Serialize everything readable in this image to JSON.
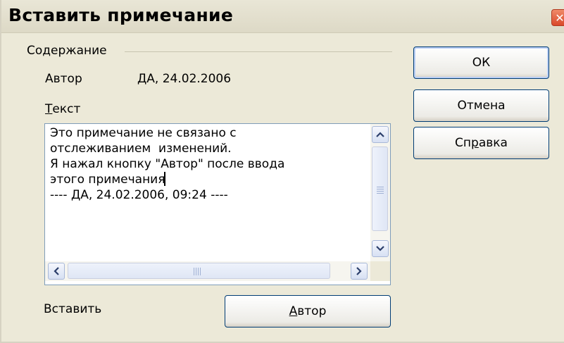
{
  "window": {
    "title": "Вставить примечание"
  },
  "contents_group": {
    "label": "Содержание"
  },
  "author": {
    "label": "Автор",
    "value": "ДА, 24.02.2006"
  },
  "text_field": {
    "label_underlined": "Т",
    "label_rest": "екст",
    "lines": [
      "Это примечание не связано с",
      "отслеживанием  изменений.",
      "Я нажал кнопку \"Автор\" после ввода",
      "этого примечания",
      "---- ДА, 24.02.2006, 09:24 ----"
    ]
  },
  "buttons": {
    "ok": "ОК",
    "cancel": "Отмена",
    "help_before": "Сп",
    "help_underlined": "р",
    "help_after": "авка",
    "author_underlined": "А",
    "author_rest": "втор"
  },
  "insert": {
    "label": "Вставить"
  },
  "icons": {
    "close": "close-icon",
    "scroll_up": "arrow-up-icon",
    "scroll_down": "arrow-down-icon",
    "scroll_left": "arrow-left-icon",
    "scroll_right": "arrow-right-icon"
  },
  "colors": {
    "accent_border": "#003c74",
    "close_button": "#d9482a",
    "dialog_bg": "#ece9d8"
  }
}
